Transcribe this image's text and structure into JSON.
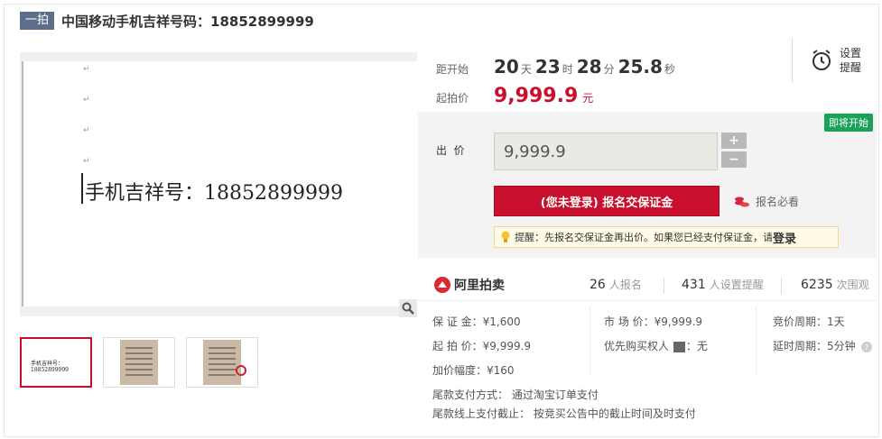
{
  "title": {
    "tag": "一拍",
    "text": "中国移动手机吉祥号码：18852899999"
  },
  "preview": {
    "doc_text": "手机吉祥号：18852899999",
    "marks": [
      "↵",
      "↵",
      "↵",
      "↵"
    ],
    "thumb_text": "手机吉祥号：18852899999"
  },
  "countdown": {
    "label": "距开始",
    "days": "20",
    "days_unit": "天",
    "hours": "23",
    "hours_unit": "时",
    "minutes": "28",
    "minutes_unit": "分",
    "seconds": "25.8",
    "seconds_unit": "秒"
  },
  "remind": {
    "label": "设置提醒"
  },
  "start_price": {
    "label": "起拍价",
    "value": "9,999.9",
    "unit": "元"
  },
  "bid": {
    "status_badge": "即将开始",
    "label": "出  价",
    "value": "9,999.9",
    "plus": "+",
    "minus": "−",
    "register_button": "(您未登录) 报名交保证金",
    "must_read": "报名必看",
    "tip_text": "提醒：先报名交保证金再出价。如果您已经支付保证金，请",
    "tip_login": "登录"
  },
  "stats": {
    "brand": "阿里拍卖",
    "signups_value": "26",
    "signups_label": "人报名",
    "reminders_value": "431",
    "reminders_label": "人设置提醒",
    "views_value": "6235",
    "views_label": "次围观"
  },
  "details": {
    "deposit": "保 证 金：¥1,600",
    "start_price": "起 拍 价：¥9,999.9",
    "increment": "加价幅度：¥160",
    "market_price": "市 场 价：¥9,999.9",
    "priority_label": "优先购买权人",
    "priority_value": "：无",
    "cycle": "竞价周期：1天",
    "delay": "延时周期：5分钟",
    "payment_method": "尾款支付方式： 通过淘宝订单支付",
    "payment_deadline": "尾款线上支付截止： 按竞买公告中的截止时间及时支付"
  },
  "colors": {
    "accent": "#c8102e",
    "badge": "#1aa259",
    "tag": "#5d6e8a"
  }
}
